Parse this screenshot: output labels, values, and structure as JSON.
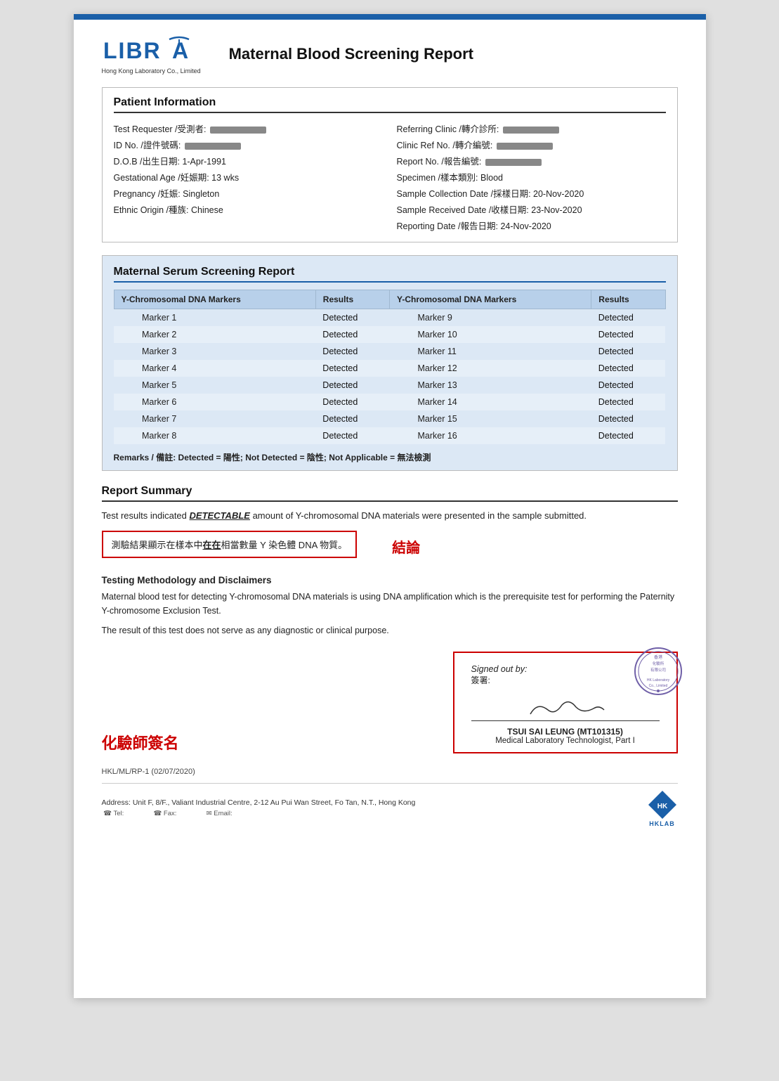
{
  "header": {
    "logo_main": "LIBRA",
    "logo_sub": "Hong Kong Laboratory Co., Limited",
    "report_title": "Maternal Blood Screening Report"
  },
  "patient_info": {
    "section_heading": "Patient Information",
    "fields_left": [
      {
        "label": "Test Requester /受測者:",
        "value": "REDACTED"
      },
      {
        "label": "ID No. /證件號碼:",
        "value": "REDACTED"
      },
      {
        "label": "D.O.B /出生日期:",
        "value": "1-Apr-1991"
      },
      {
        "label": "Gestational Age /妊娠期:",
        "value": "13 wks"
      },
      {
        "label": "Pregnancy /妊娠:",
        "value": "Singleton"
      },
      {
        "label": "Ethnic Origin /種族:",
        "value": "Chinese"
      }
    ],
    "fields_right": [
      {
        "label": "Referring Clinic /轉介診所:",
        "value": "REDACTED"
      },
      {
        "label": "Clinic Ref No. /轉介編號:",
        "value": "REDACTED"
      },
      {
        "label": "Report No. /報告編號:",
        "value": "REDACTED"
      },
      {
        "label": "Specimen /樣本類別:",
        "value": "Blood"
      },
      {
        "label": "Sample Collection Date /採樣日期:",
        "value": "20-Nov-2020"
      },
      {
        "label": "Sample Received Date /收樣日期:",
        "value": "23-Nov-2020"
      },
      {
        "label": "Reporting Date /報告日期:",
        "value": "24-Nov-2020"
      }
    ]
  },
  "screening": {
    "section_heading": "Maternal Serum Screening Report",
    "col1_header": "Y-Chromosomal DNA Markers",
    "col2_header": "Results",
    "col3_header": "Y-Chromosomal DNA Markers",
    "col4_header": "Results",
    "markers_left": [
      {
        "marker": "Marker 1",
        "result": "Detected"
      },
      {
        "marker": "Marker 2",
        "result": "Detected"
      },
      {
        "marker": "Marker 3",
        "result": "Detected"
      },
      {
        "marker": "Marker 4",
        "result": "Detected"
      },
      {
        "marker": "Marker 5",
        "result": "Detected"
      },
      {
        "marker": "Marker 6",
        "result": "Detected"
      },
      {
        "marker": "Marker 7",
        "result": "Detected"
      },
      {
        "marker": "Marker 8",
        "result": "Detected"
      }
    ],
    "markers_right": [
      {
        "marker": "Marker 9",
        "result": "Detected"
      },
      {
        "marker": "Marker 10",
        "result": "Detected"
      },
      {
        "marker": "Marker 11",
        "result": "Detected"
      },
      {
        "marker": "Marker 12",
        "result": "Detected"
      },
      {
        "marker": "Marker 13",
        "result": "Detected"
      },
      {
        "marker": "Marker 14",
        "result": "Detected"
      },
      {
        "marker": "Marker 15",
        "result": "Detected"
      },
      {
        "marker": "Marker 16",
        "result": "Detected"
      }
    ],
    "remarks": "Remarks / 備註: Detected = 陽性; Not Detected = 陰性; Not Applicable = 無法檢測"
  },
  "summary": {
    "section_heading": "Report Summary",
    "text1": "Test results indicated ",
    "detectable": "DETECTABLE",
    "text2": " amount of Y-chromosomal DNA materials were presented in the sample submitted.",
    "cn_text_pre": "測驗結果顯示在樣本中",
    "cn_bold": "在在",
    "cn_text_post": "相當數量 Y 染色體 DNA 物質。",
    "conclusion_label": "結論"
  },
  "methodology": {
    "heading": "Testing Methodology and Disclaimers",
    "text1": "Maternal blood test for detecting Y-chromosomal DNA materials is using DNA amplification which is the prerequisite test for performing the Paternity Y-chromosome Exclusion Test.",
    "text2": "The result of this test does not serve as any diagnostic or clinical purpose."
  },
  "signature": {
    "chemist_label": "化驗師簽名",
    "signed_out_by": "Signed out by:",
    "signed_out_by_cn": "簽署:",
    "signee_name": "TSUI SAI LEUNG (MT101315)",
    "signee_title": "Medical Laboratory Technologist, Part I"
  },
  "footer": {
    "doc_ref": "HKL/ML/RP-1 (02/07/2020)",
    "address": "Address: Unit F, 8/F., Valiant Industrial Centre, 2-12 Au Pui Wan Street, Fo Tan, N.T., Hong Kong",
    "hklab": "HKLAB"
  }
}
